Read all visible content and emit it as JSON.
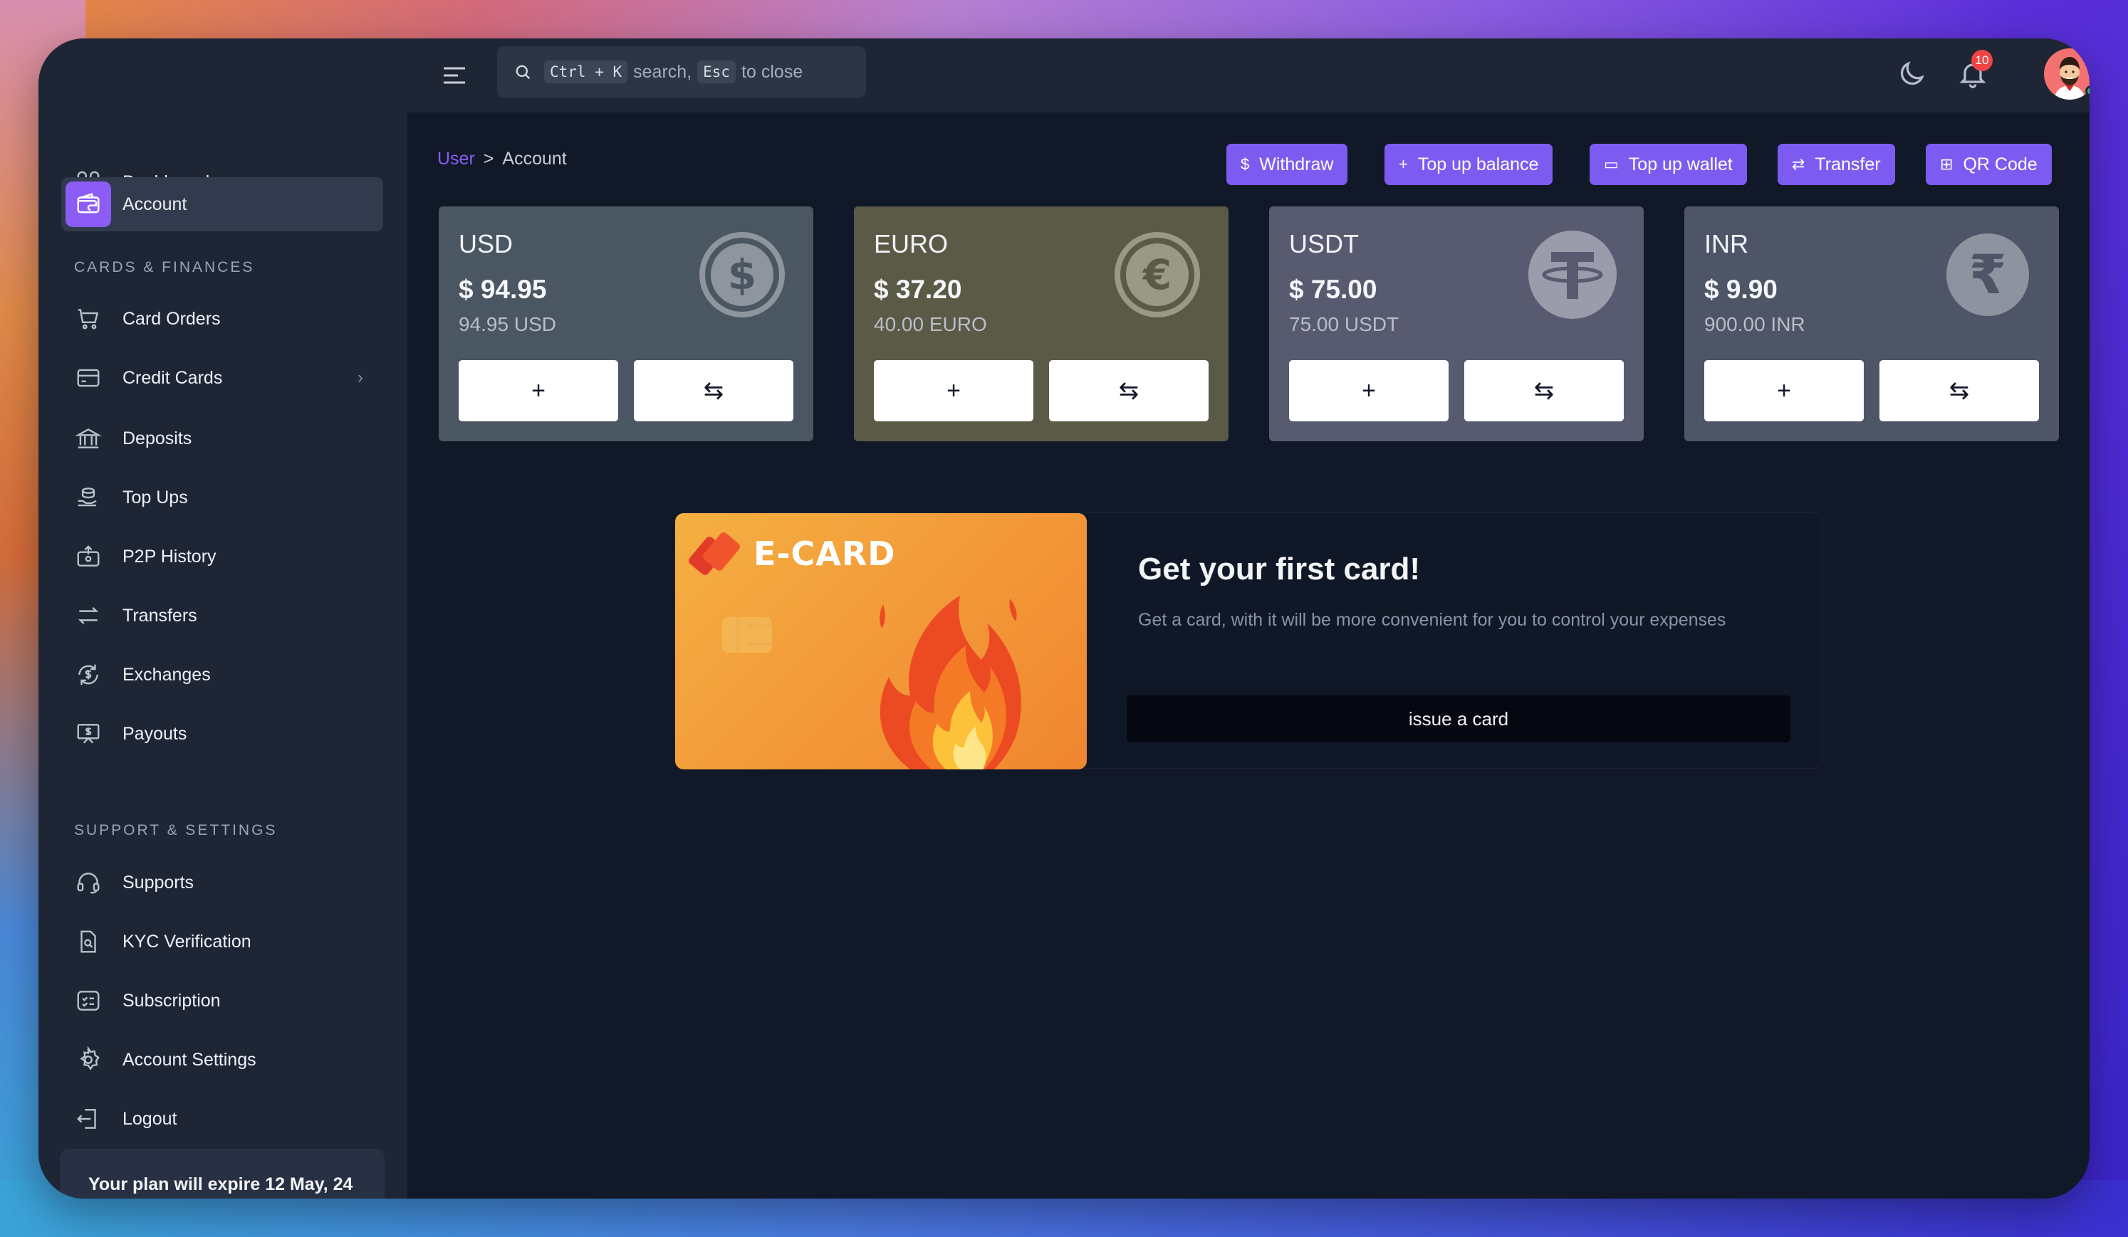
{
  "sidebar": {
    "items": [
      {
        "label": "Dashboard",
        "icon": "grid-icon"
      },
      {
        "label": "Account",
        "icon": "wallet-icon"
      },
      {
        "label": "Card Orders",
        "icon": "cart-icon"
      },
      {
        "label": "Credit Cards",
        "icon": "credit-card-icon"
      },
      {
        "label": "Deposits",
        "icon": "bank-icon"
      },
      {
        "label": "Top Ups",
        "icon": "coins-hand-icon"
      },
      {
        "label": "P2P History",
        "icon": "p2p-icon"
      },
      {
        "label": "Transfers",
        "icon": "transfer-icon"
      },
      {
        "label": "Exchanges",
        "icon": "exchange-icon"
      },
      {
        "label": "Payouts",
        "icon": "payout-icon"
      },
      {
        "label": "Supports",
        "icon": "headset-icon"
      },
      {
        "label": "KYC Verification",
        "icon": "document-search-icon"
      },
      {
        "label": "Subscription",
        "icon": "checklist-icon"
      },
      {
        "label": "Account Settings",
        "icon": "gear-icon"
      },
      {
        "label": "Logout",
        "icon": "logout-icon"
      }
    ],
    "sections": {
      "cards": "CARDS & FINANCES",
      "support": "SUPPORT & SETTINGS"
    },
    "plan_text": "Your plan will expire 12 May, 24"
  },
  "topbar": {
    "search": {
      "kbd1": "Ctrl + K",
      "text1": "search,",
      "kbd2": "Esc",
      "text2": "to close"
    },
    "notification_count": "10"
  },
  "breadcrumb": {
    "parent": "User",
    "separator": ">",
    "current": "Account"
  },
  "actions": [
    {
      "label": "Withdraw",
      "icon": "$"
    },
    {
      "label": "Top up balance",
      "icon": "+"
    },
    {
      "label": "Top up wallet",
      "icon": "▭"
    },
    {
      "label": "Transfer",
      "icon": "⇄"
    },
    {
      "label": "QR Code",
      "icon": "⊞"
    }
  ],
  "wallets": [
    {
      "currency": "USD",
      "amount": "$ 94.95",
      "sub": "94.95 USD",
      "color": "#4a5661",
      "coin": "dollar-coin-icon"
    },
    {
      "currency": "EURO",
      "amount": "$ 37.20",
      "sub": "40.00 EURO",
      "color": "#5b5a47",
      "coin": "euro-coin-icon"
    },
    {
      "currency": "USDT",
      "amount": "$ 75.00",
      "sub": "75.00 USDT",
      "color": "#585a70",
      "coin": "tether-coin-icon"
    },
    {
      "currency": "INR",
      "amount": "$ 9.90",
      "sub": "900.00 INR",
      "color": "#4d5566",
      "coin": "rupee-coin-icon"
    }
  ],
  "wallet_buttons": {
    "add": "+",
    "exchange": "⇆"
  },
  "promo": {
    "card_label": "E-CARD",
    "title": "Get your first card!",
    "description": "Get a card, with it will be more convenient for you to control your expenses",
    "button": "issue a card"
  }
}
